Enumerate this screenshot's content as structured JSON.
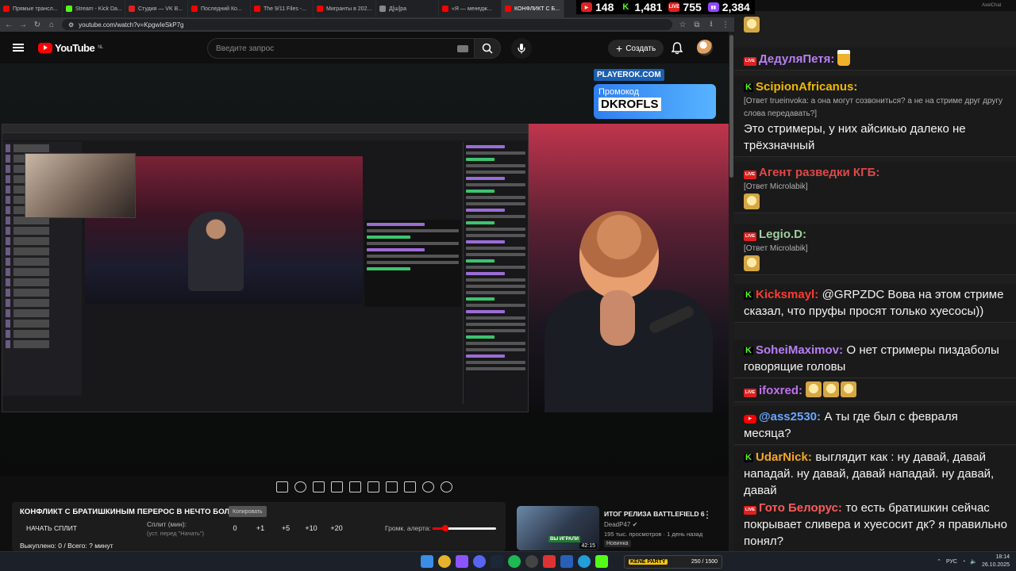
{
  "browser": {
    "tabs": [
      {
        "label": "Прямые трансл...",
        "color": "#ff0000"
      },
      {
        "label": "Stream - Kick Da...",
        "color": "#53fc18"
      },
      {
        "label": "Студия — VK В...",
        "color": "#e02020"
      },
      {
        "label": "Последний Ко...",
        "color": "#ff0000"
      },
      {
        "label": "The 9/11 Files -...",
        "color": "#ff0000"
      },
      {
        "label": "Мигранты в 202...",
        "color": "#ff0000"
      },
      {
        "label": "Д[ш]ра",
        "color": "#888888"
      },
      {
        "label": "«Я — менедж...",
        "color": "#ff0000"
      },
      {
        "label": "КОНФЛИКТ С Б...",
        "color": "#ff0000"
      }
    ],
    "url": "youtube.com/watch?v=KpgwIeSkP7g"
  },
  "stats": [
    {
      "platform": "live",
      "value": "148",
      "color": "#e02020"
    },
    {
      "platform": "kick",
      "value": "1,481",
      "color": "#53fc18"
    },
    {
      "platform": "vk",
      "value": "755",
      "color": "#e02020"
    },
    {
      "platform": "twitch",
      "value": "2,384",
      "color": "#9147ff"
    }
  ],
  "youtube": {
    "logo": "YouTube",
    "region": "NL",
    "search_placeholder": "Введите запрос",
    "create_label": "Создать"
  },
  "player": {
    "promo_site": "PLAYEROK.COM",
    "promo_label": "Промокод",
    "promo_code": "DKROFLS"
  },
  "panel": {
    "title": "КОНФЛИКТ С БРАТИШКИНЫМ ПЕРЕРОС В НЕЧТО БОЛЬШЕЕ...",
    "copy": "Копировать",
    "start_split": "НАЧАТЬ СПЛИТ",
    "split_label": "Сплит (мин):",
    "split_sub": "(уст. перед \"Начать\")",
    "split_values": [
      "0",
      "+1",
      "+5",
      "+10",
      "+20"
    ],
    "alert_label": "Громк. алерта:",
    "alert_volume": 0.2,
    "bought": "Выкуплено: 0 / Всего: ? минут"
  },
  "recommended": {
    "title": "ИТОГ РЕЛИЗА BATTLEFIELD 6",
    "channel": "DeadP47",
    "meta": "195 тыс. просмотров · 1 день назад",
    "badge": "Новинка",
    "duration": "42:15",
    "thumb_label": "ВЫ ИГРАЛИ"
  },
  "chat": {
    "app": "AxelChat",
    "messages": [
      {
        "platform": "vk",
        "nick": "ДедуляПетя:",
        "nick_color": "#b87ff5",
        "text": "",
        "emote": "beer"
      },
      {
        "platform": "kick",
        "nick": "ScipionAfricanus:",
        "nick_color": "#f0b800",
        "reply": "[Ответ trueinvoka: а она могут созвониться? а не на стриме друг другу слова передавать?]",
        "text": "Это стримеры, у них айсикью далеко не трёхзначный"
      },
      {
        "platform": "vk",
        "nick": "Агент разведки КГБ:",
        "nick_color": "#e04848",
        "reply": "[Ответ Microlabik]",
        "text": "",
        "emote": "dog"
      },
      {
        "platform": "vk",
        "nick": "Legio.D:",
        "nick_color": "#9fd0a0",
        "reply": "[Ответ Microlabik]",
        "text": "",
        "emote": "dog"
      },
      {
        "platform": "kick",
        "nick": "Kicksmayl:",
        "nick_color": "#ff3b30",
        "text": "@GRPZDC Вова на этом стриме сказал, что пруфы просят только хуесосы))"
      },
      {
        "platform": "kick",
        "nick": "SoheiMaximov:",
        "nick_color": "#b87ff5",
        "text": "О нет стримеры пиздаболы говорящие головы"
      },
      {
        "platform": "vk",
        "nick": "ifoxred:",
        "nick_color": "#c070f0",
        "text": "",
        "emote": "dogs"
      },
      {
        "platform": "yt",
        "nick": "@ass2530:",
        "nick_color": "#6aa7ff",
        "text": "А ты где был с февраля месяца?"
      },
      {
        "platform": "kick",
        "nick": "UdarNick:",
        "nick_color": "#f5a623",
        "text": "выглядит как : ну давай, давай нападай. ну давай, давай нападай. ну давай, давай"
      },
      {
        "platform": "vk",
        "nick": "Гото Белорус:",
        "nick_color": "#ff5a5a",
        "text": "то есть братишкин сейчас покрывает сливера и хуесосит дк? я правильно понял?"
      }
    ]
  },
  "taskbar": {
    "kene": "KENE PARTY",
    "kene_value": "250 / 1500",
    "lang": "РУС",
    "time": "18:14",
    "date": "26.10.2025"
  }
}
